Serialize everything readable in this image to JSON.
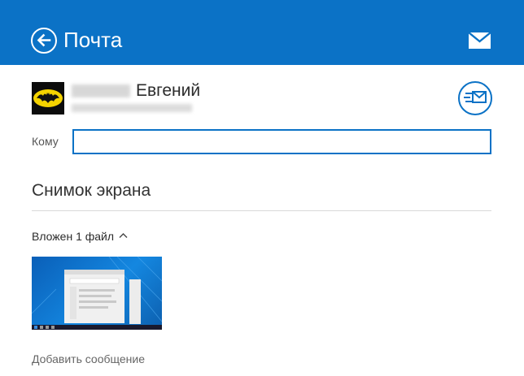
{
  "header": {
    "title": "Почта",
    "back_icon": "back-arrow-circle-icon",
    "mail_icon": "envelope-icon",
    "background": "#0b72c6"
  },
  "sender": {
    "name": "Евгений",
    "avatar": "batman-logo"
  },
  "compose": {
    "to_label": "Кому",
    "to_value": "",
    "send_icon": "send-mail-icon",
    "subject": "Снимок экрана",
    "attachments_label": "Вложен 1 файл",
    "attachments_toggle_icon": "chevron-up-icon",
    "add_message": "Добавить сообщение"
  },
  "colors": {
    "accent": "#0b72c6"
  }
}
